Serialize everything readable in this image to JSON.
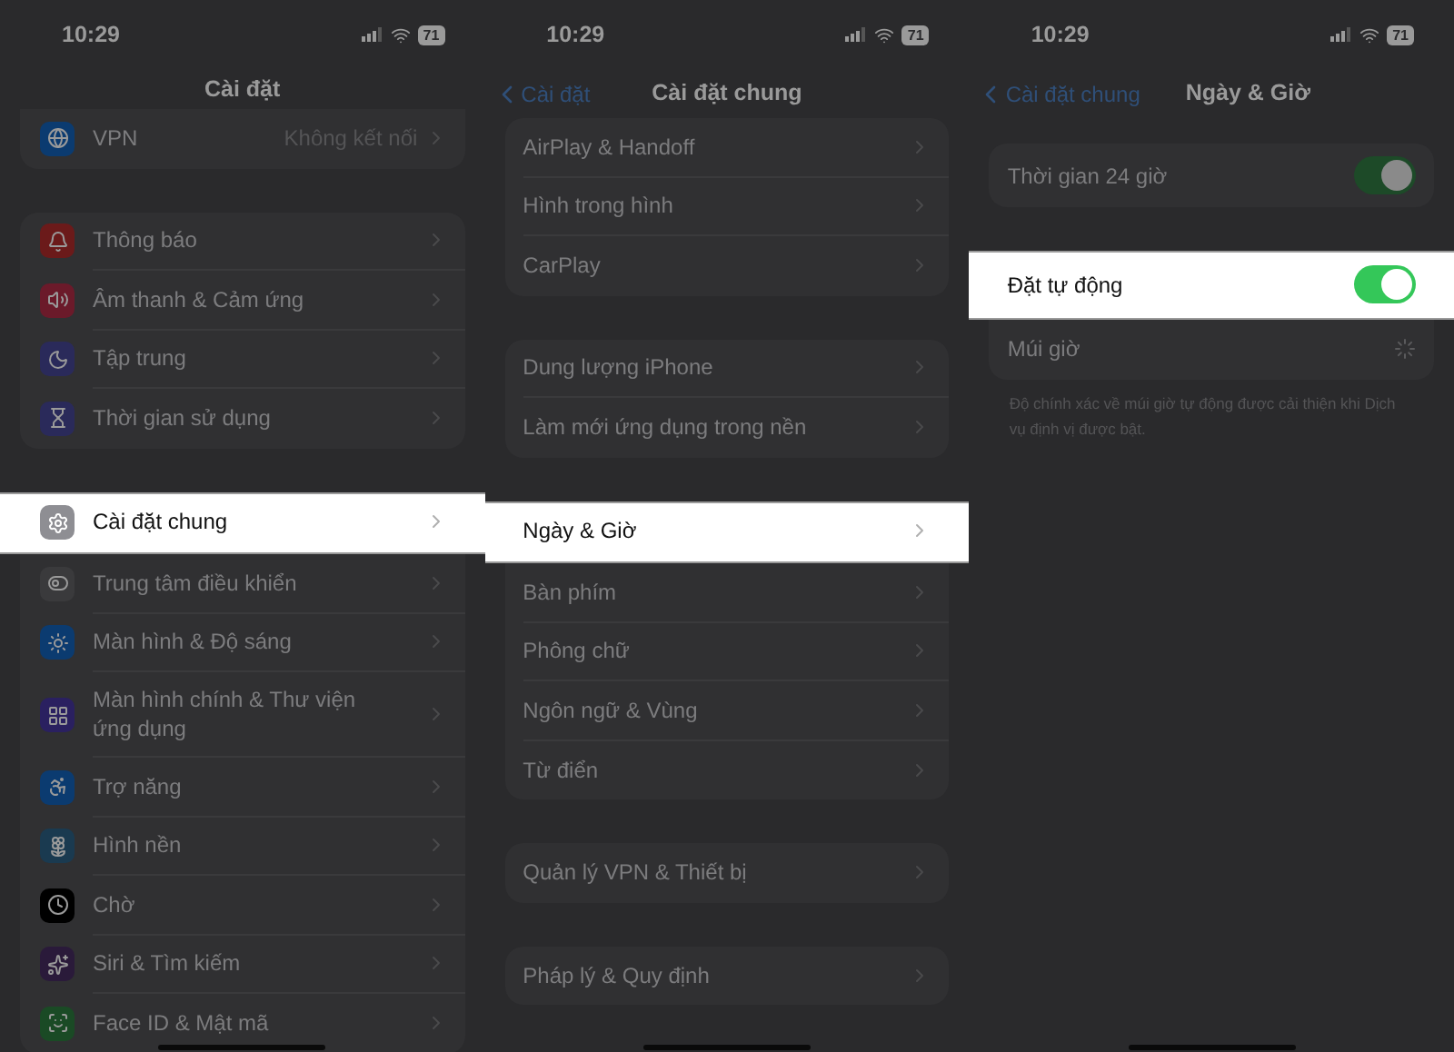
{
  "panels": [
    {
      "status": {
        "time": "10:29",
        "battery": "71"
      },
      "nav": {
        "title": "Cài đặt"
      },
      "groups": [
        {
          "rows": [
            {
              "kind": "nav",
              "label": "VPN",
              "value": "Không kết nối",
              "color": "#0b3b70",
              "highlighted": false
            }
          ]
        },
        {
          "rows": [
            {
              "kind": "nav",
              "label": "Thông báo",
              "color": "#6b1a1a",
              "highlighted": false
            },
            {
              "kind": "nav",
              "label": "Âm thanh & Cảm ứng",
              "color": "#6b1a2a",
              "highlighted": false
            },
            {
              "kind": "nav",
              "label": "Tập trung",
              "color": "#2a2a5a",
              "highlighted": false
            },
            {
              "kind": "nav",
              "label": "Thời gian sử dụng",
              "color": "#2a2a5a",
              "highlighted": false
            }
          ]
        },
        {
          "rows": [
            {
              "kind": "nav",
              "label": "Cài đặt chung",
              "color": "#8e8e93",
              "highlighted": true
            },
            {
              "kind": "nav",
              "label": "Trung tâm điều khiển",
              "color": "#3a3a3c",
              "highlighted": false
            },
            {
              "kind": "nav",
              "label": "Màn hình & Độ sáng",
              "color": "#0b3b70",
              "highlighted": false
            },
            {
              "kind": "nav",
              "label": "Màn hình chính & Thư viện ứng dụng",
              "color": "#2a2060",
              "highlighted": false
            },
            {
              "kind": "nav",
              "label": "Trợ năng",
              "color": "#0b3b70",
              "highlighted": false
            },
            {
              "kind": "nav",
              "label": "Hình nền",
              "color": "#1a3a50",
              "highlighted": false
            },
            {
              "kind": "nav",
              "label": "Chờ",
              "color": "#000000",
              "highlighted": false
            },
            {
              "kind": "nav",
              "label": "Siri & Tìm kiếm",
              "color": "#2a1a3a",
              "highlighted": false
            },
            {
              "kind": "nav",
              "label": "Face ID & Mật mã",
              "color": "#1a4a25",
              "highlighted": false
            }
          ]
        }
      ]
    },
    {
      "status": {
        "time": "10:29",
        "battery": "71"
      },
      "nav": {
        "back": "Cài đặt",
        "title": "Cài đặt chung"
      },
      "groups": [
        {
          "rows": [
            {
              "kind": "nav",
              "label": "AirPlay & Handoff",
              "highlighted": false
            },
            {
              "kind": "nav",
              "label": "Hình trong hình",
              "highlighted": false
            },
            {
              "kind": "nav",
              "label": "CarPlay",
              "highlighted": false
            }
          ]
        },
        {
          "rows": [
            {
              "kind": "nav",
              "label": "Dung lượng iPhone",
              "highlighted": false
            },
            {
              "kind": "nav",
              "label": "Làm mới ứng dụng trong nền",
              "highlighted": false
            }
          ]
        },
        {
          "rows": [
            {
              "kind": "nav",
              "label": "Ngày & Giờ",
              "highlighted": true
            },
            {
              "kind": "nav",
              "label": "Bàn phím",
              "highlighted": false
            },
            {
              "kind": "nav",
              "label": "Phông chữ",
              "highlighted": false
            },
            {
              "kind": "nav",
              "label": "Ngôn ngữ & Vùng",
              "highlighted": false
            },
            {
              "kind": "nav",
              "label": "Từ điển",
              "highlighted": false
            }
          ]
        },
        {
          "rows": [
            {
              "kind": "nav",
              "label": "Quản lý VPN & Thiết bị",
              "highlighted": false
            }
          ]
        },
        {
          "rows": [
            {
              "kind": "nav",
              "label": "Pháp lý & Quy định",
              "highlighted": false
            }
          ]
        }
      ]
    },
    {
      "status": {
        "time": "10:29",
        "battery": "71"
      },
      "nav": {
        "back": "Cài đặt chung",
        "title": "Ngày & Giờ"
      },
      "groups": [
        {
          "rows": [
            {
              "kind": "toggle",
              "label": "Thời gian 24 giờ",
              "on": true,
              "highlighted": false
            }
          ]
        },
        {
          "rows": [
            {
              "kind": "toggle",
              "label": "Đặt tự động",
              "on": true,
              "highlighted": true
            },
            {
              "kind": "spinner",
              "label": "Múi giờ",
              "highlighted": false
            }
          ],
          "footer": "Độ chính xác về múi giờ tự động được cải thiện khi Dịch vụ định vị được bật."
        }
      ]
    }
  ]
}
